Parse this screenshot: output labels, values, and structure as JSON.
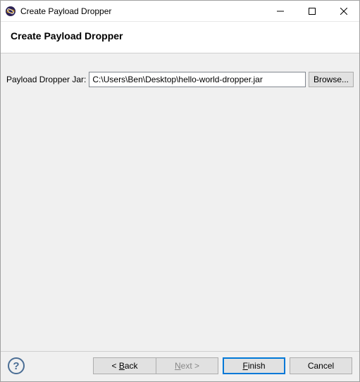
{
  "titlebar": {
    "title": "Create Payload Dropper"
  },
  "header": {
    "title": "Create Payload Dropper"
  },
  "content": {
    "jar_label": "Payload Dropper Jar:",
    "jar_path": "C:\\Users\\Ben\\Desktop\\hello-world-dropper.jar",
    "browse_label": "Browse..."
  },
  "footer": {
    "help_symbol": "?",
    "back_prefix": "< ",
    "back_u": "B",
    "back_suffix": "ack",
    "next_u": "N",
    "next_suffix": "ext >",
    "finish_u": "F",
    "finish_suffix": "inish",
    "cancel_label": "Cancel"
  }
}
